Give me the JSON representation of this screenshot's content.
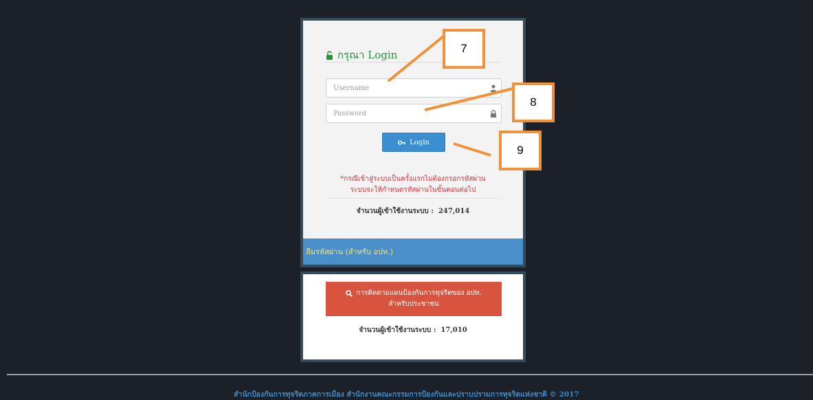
{
  "login": {
    "heading": "กรุณา Login",
    "username_placeholder": "Username",
    "password_placeholder": "Password",
    "button_label": "Login",
    "note_line1": "*กรณีเข้าสู่ระบบเป็นครั้งแรกไม่ต้องกรอกรหัสผ่าน",
    "note_line2": "ระบบจะให้กำหนดรหัสผ่านในขั้นตอนต่อไป",
    "user_count_label": "จำนวนผู้เข้าใช้งานระบบ :",
    "user_count_value": "247,014",
    "forgot_password": "ลืมรหัสผ่าน (สำหรับ อปท.)"
  },
  "plan": {
    "button_line1": "การติดตามแผนป้องกันการทุจริตของ อปท.",
    "button_line2": "สำหรับประชาชน",
    "user_count_label": "จำนวนผู้เข้าใช้งานระบบ :",
    "user_count_value": "17,010"
  },
  "footer": {
    "text": "สำนักป้องกันการทุจริตภาคการเมือง สำนักงานคณะกรรมการป้องกันและปราบปรามการทุจริตแห่งชาติ © 2017"
  },
  "callouts": {
    "c7": "7",
    "c8": "8",
    "c9": "9"
  },
  "colors": {
    "background": "#1c2028",
    "panel_border": "#374a5a",
    "login_button": "#3b8fd0",
    "forgot_bar": "#4a8fc8",
    "plan_button": "#d9543f",
    "note_text": "#e0303a",
    "callout_border": "#f0923a"
  },
  "icons": {
    "heading": "unlock-icon",
    "username": "user-icon",
    "password": "lock-icon",
    "login_button": "key-icon",
    "plan_button": "search-icon"
  }
}
